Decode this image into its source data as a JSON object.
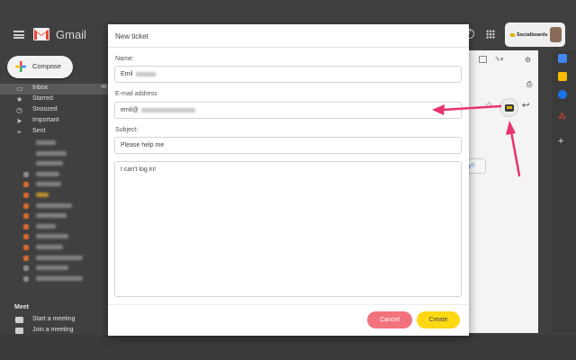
{
  "gmail": {
    "brand": "Gmail",
    "compose_label": "Compose",
    "nav": [
      {
        "label": "Inbox",
        "count": "46",
        "icon": "inbox-icon"
      },
      {
        "label": "Starred",
        "icon": "star-icon"
      },
      {
        "label": "Snoozed",
        "icon": "clock-icon"
      },
      {
        "label": "Important",
        "icon": "label-important-icon"
      },
      {
        "label": "Sent",
        "icon": "send-icon"
      }
    ],
    "meet": {
      "title": "Meet",
      "start": "Start a meeting",
      "join": "Join a meeting"
    },
    "partial_text": "y?",
    "why_chip": "hy?"
  },
  "extension": {
    "account_label": "Socialboards"
  },
  "modal": {
    "title": "New ticket",
    "name_label": "Name:",
    "name_value": "Emil",
    "email_label": "E-mail address",
    "email_value": "emil@",
    "subject_label": "Subject:",
    "subject_value": "Please help me",
    "message_value": "I can't log in!",
    "cancel_label": "Cancel",
    "create_label": "Create"
  },
  "colors": {
    "arrow": "#e8336e",
    "cancel": "#f2737c",
    "create": "#ffd814",
    "gmail_red": "#ea4335"
  }
}
